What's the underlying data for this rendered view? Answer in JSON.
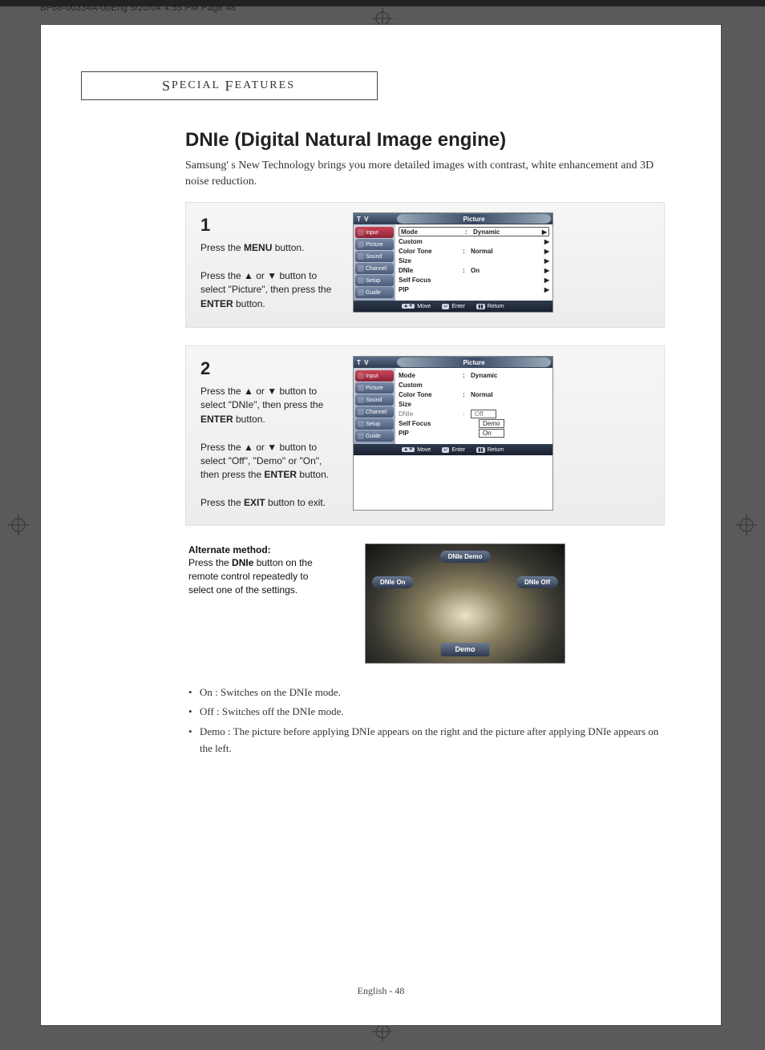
{
  "header_strip": "BP68-00334A-00Eng  5/20/04  4:55 PM  Page 48",
  "tab": {
    "line": "SPECIAL FEATURES"
  },
  "title": "DNIe (Digital Natural Image engine)",
  "intro": "Samsung' s New Technology brings you more detailed images with contrast, white enhancement and 3D noise reduction.",
  "step1": {
    "num": "1",
    "p1_a": "Press the ",
    "p1_b": "MENU",
    "p1_c": " button.",
    "p2": "Press the ▲ or ▼ button to select \"Picture\", then press the ",
    "p2_b": "ENTER",
    "p2_c": " button."
  },
  "step2": {
    "num": "2",
    "p1": "Press the ▲ or ▼ button to select \"DNIe\", then press the ",
    "p1_b": "ENTER",
    "p1_c": " button.",
    "p2": "Press the ▲ or ▼ button to select \"Off\", \"Demo\" or \"On\", then press the ",
    "p2_b": "ENTER",
    "p2_c": " button.",
    "p3_a": "Press the ",
    "p3_b": "EXIT",
    "p3_c": " button to exit."
  },
  "osd": {
    "tv": "T V",
    "section": "Picture",
    "side": [
      "Input",
      "Picture",
      "Sound",
      "Channel",
      "Setup",
      "Guide"
    ],
    "rows1": [
      {
        "k": "Mode",
        "v": "Dynamic",
        "hl": true
      },
      {
        "k": "Custom",
        "v": ""
      },
      {
        "k": "Color Tone",
        "v": "Normal"
      },
      {
        "k": "Size",
        "v": ""
      },
      {
        "k": "DNIe",
        "v": "On"
      },
      {
        "k": "Self Focus",
        "v": ""
      },
      {
        "k": "PIP",
        "v": ""
      }
    ],
    "rows2": {
      "mode": {
        "k": "Mode",
        "v": "Dynamic"
      },
      "custom": {
        "k": "Custom",
        "v": ""
      },
      "color": {
        "k": "Color Tone",
        "v": "Normal"
      },
      "size": {
        "k": "Size",
        "v": ""
      },
      "dnie": {
        "k": "DNIe",
        "opts": [
          "Off",
          "Demo",
          "On"
        ]
      },
      "self": {
        "k": "Self Focus",
        "v": ""
      },
      "pip": {
        "k": "PIP",
        "v": ""
      }
    },
    "footer": {
      "move": "Move",
      "enter": "Enter",
      "return": "Return"
    }
  },
  "alt": {
    "heading": "Alternate method:",
    "body_a": "Press the ",
    "body_b": "DNIe",
    "body_c": " button on the remote control repeatedly to select one of the settings.",
    "pill_top": "DNIe  Demo",
    "pill_left": "DNIe  On",
    "pill_right": "DNIe  Off",
    "demo_label": "Demo"
  },
  "bullets": [
    "On : Switches on the DNIe mode.",
    "Off : Switches off the DNIe mode.",
    "Demo : The picture before applying DNIe appears on the right and the picture after applying DNIe appears on the left."
  ],
  "pageno": "English - 48"
}
